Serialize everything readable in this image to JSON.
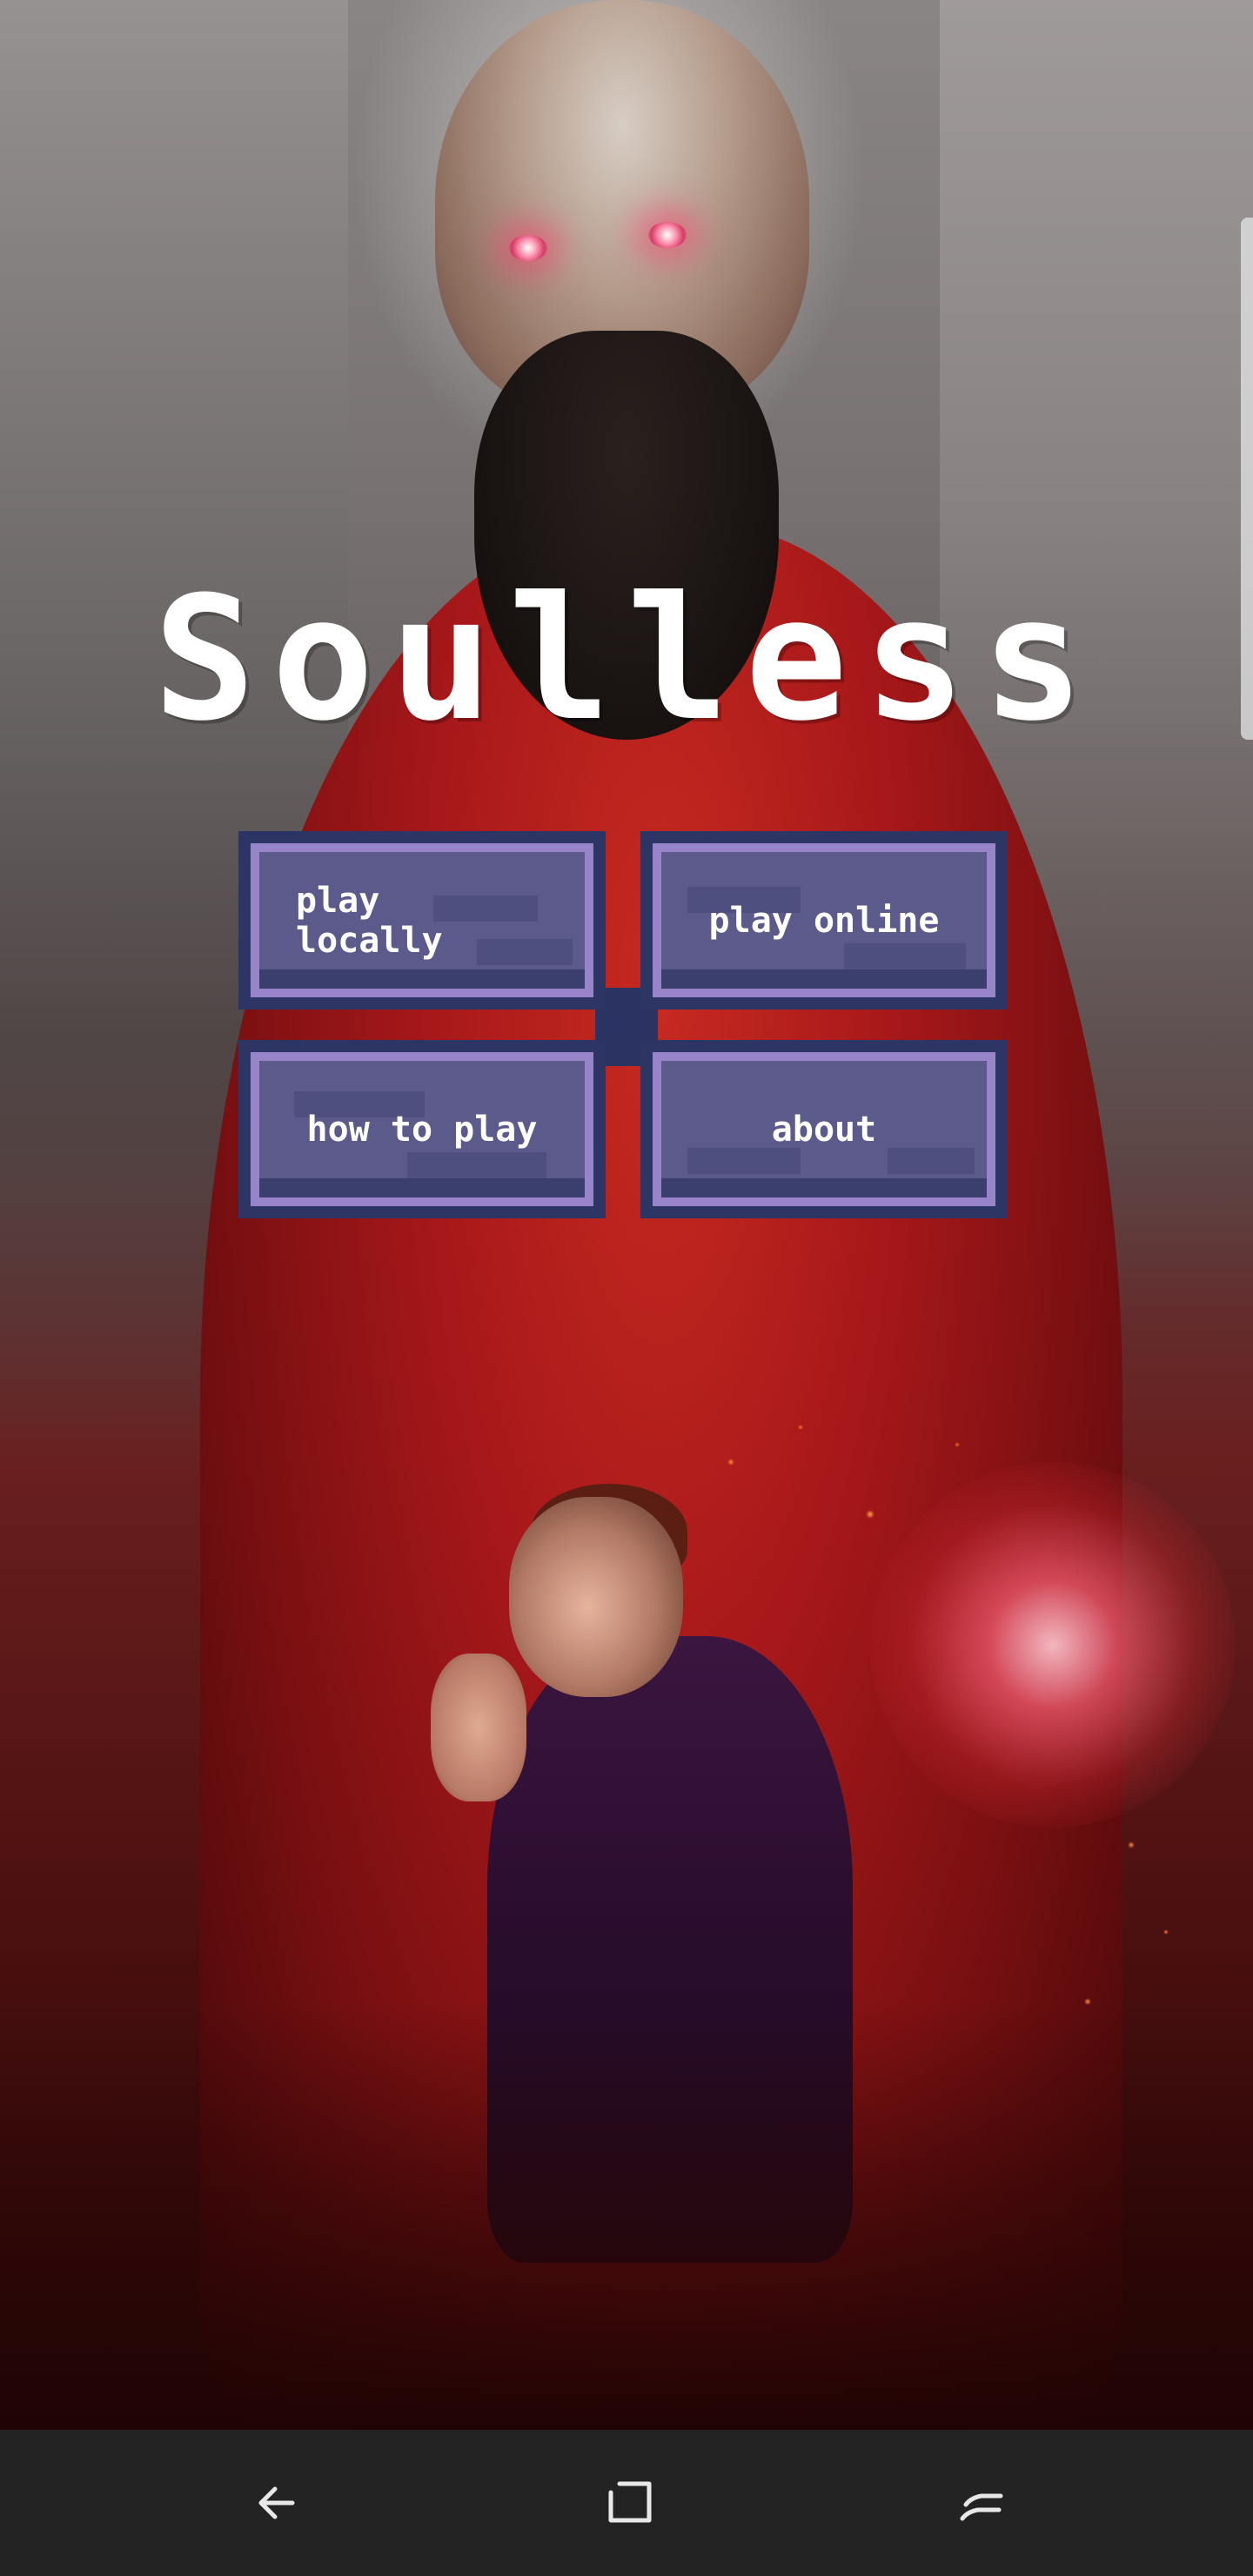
{
  "game": {
    "title": "Soulless"
  },
  "menu": {
    "buttons": [
      {
        "id": "play-locally",
        "label_line1": "play",
        "label_line2": "locally"
      },
      {
        "id": "play-online",
        "label": "play online"
      },
      {
        "id": "how-to-play",
        "label": "how to play"
      },
      {
        "id": "about",
        "label": "about"
      }
    ]
  },
  "navigation": {
    "icons": [
      "back-icon",
      "home-icon",
      "recent-apps-icon"
    ]
  },
  "colors": {
    "button_face": "#5b5a8b",
    "button_border": "#2d3564",
    "button_highlight": "#9784c9",
    "title_text": "#ffffff",
    "navbar_bg": "#232323"
  }
}
